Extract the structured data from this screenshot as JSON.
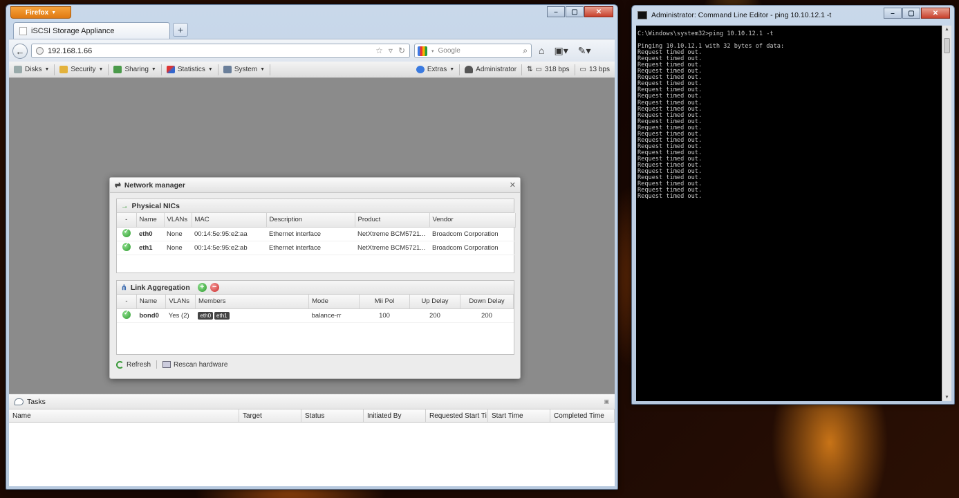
{
  "firefox": {
    "menu_label": "Firefox",
    "tab_title": "iSCSI Storage Appliance",
    "url": "192.168.1.66",
    "search_placeholder": "Google"
  },
  "toolbar": {
    "disks": "Disks",
    "security": "Security",
    "sharing": "Sharing",
    "statistics": "Statistics",
    "system": "System",
    "extras": "Extras",
    "user": "Administrator",
    "rate_in": "318 bps",
    "rate_out": "13 bps"
  },
  "network_manager": {
    "title": "Network manager",
    "physical": {
      "heading": "Physical NICs",
      "columns": [
        "-",
        "Name",
        "VLANs",
        "MAC",
        "Description",
        "Product",
        "Vendor"
      ],
      "rows": [
        {
          "name": "eth0",
          "vlans": "None",
          "mac": "00:14:5e:95:e2:aa",
          "description": "Ethernet interface",
          "product": "NetXtreme BCM5721...",
          "vendor": "Broadcom Corporation"
        },
        {
          "name": "eth1",
          "vlans": "None",
          "mac": "00:14:5e:95:e2:ab",
          "description": "Ethernet interface",
          "product": "NetXtreme BCM5721...",
          "vendor": "Broadcom Corporation"
        }
      ]
    },
    "aggregation": {
      "heading": "Link Aggregation",
      "columns": [
        "-",
        "Name",
        "VLANs",
        "Members",
        "Mode",
        "Mii Pol",
        "Up Delay",
        "Down Delay"
      ],
      "rows": [
        {
          "name": "bond0",
          "vlans": "Yes (2)",
          "members": [
            "eth0",
            "eth1"
          ],
          "mode": "balance-rr",
          "mii_pol": "100",
          "up_delay": "200",
          "down_delay": "200"
        }
      ]
    },
    "refresh": "Refresh",
    "rescan": "Rescan hardware"
  },
  "tasks": {
    "title": "Tasks",
    "columns": [
      "Name",
      "Target",
      "Status",
      "Initiated By",
      "Requested Start Ti",
      "Start Time",
      "Completed Time"
    ]
  },
  "cmd": {
    "title": "Administrator: Command Line Editor - ping  10.10.12.1 -t",
    "prompt": "C:\\Windows\\system32>ping 10.10.12.1 -t",
    "pinging": "Pinging 10.10.12.1 with 32 bytes of data:",
    "timeout_line": "Request timed out.",
    "timeout_count": 24
  }
}
